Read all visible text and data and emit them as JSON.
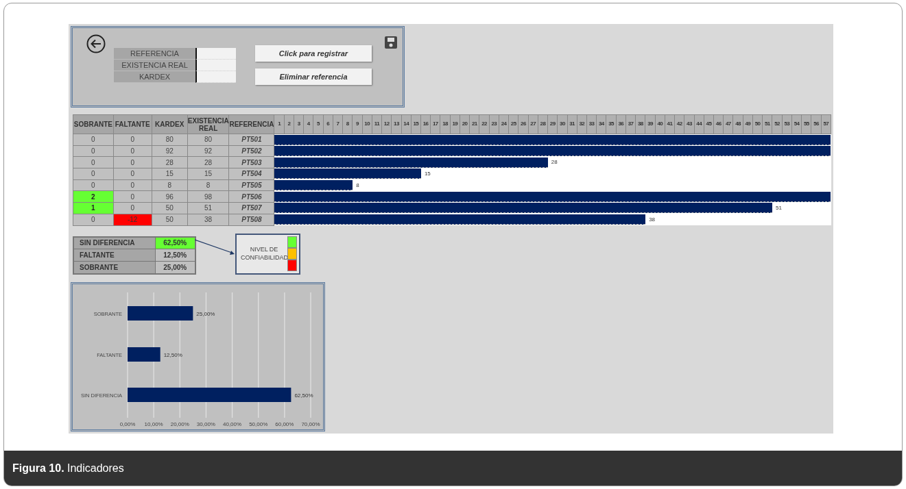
{
  "form": {
    "fields": [
      {
        "label": "REFERENCIA"
      },
      {
        "label": "EXISTENCIA REAL"
      },
      {
        "label": "KARDEX"
      }
    ],
    "buttons": [
      "Click para registrar",
      "Eliminar referencia"
    ]
  },
  "table": {
    "columns": [
      "SOBRANTE",
      "FALTANTE",
      "KARDEX",
      "EXISTENCIA REAL",
      "REFERENCIA"
    ],
    "column_numbers": [
      "1",
      "2",
      "3",
      "4",
      "5",
      "6",
      "7",
      "8",
      "9",
      "10",
      "11",
      "12",
      "13",
      "14",
      "15",
      "16",
      "17",
      "18",
      "19",
      "20",
      "21",
      "22",
      "23",
      "24",
      "25",
      "26",
      "27",
      "28",
      "29",
      "30",
      "31",
      "32",
      "33",
      "34",
      "35",
      "36",
      "37",
      "38",
      "39",
      "40",
      "41",
      "42",
      "43",
      "44",
      "45",
      "46",
      "47",
      "48",
      "49",
      "50",
      "51",
      "52",
      "53",
      "54",
      "55",
      "56",
      "57"
    ],
    "rows": [
      {
        "kind": "match",
        "sobrante": "0",
        "faltante": "0",
        "kardex": "80",
        "existencia_real": "80",
        "referencia": "PT501",
        "level": 1
      },
      {
        "kind": "match",
        "sobrante": "0",
        "faltante": "0",
        "kardex": "92",
        "existencia_real": "92",
        "referencia": "PT502",
        "level": 1
      },
      {
        "kind": "match",
        "sobrante": "0",
        "faltante": "0",
        "kardex": "28",
        "existencia_real": "28",
        "referencia": "PT503",
        "level": 0.4912,
        "bar_label": "28"
      },
      {
        "kind": "match",
        "sobrante": "0",
        "faltante": "0",
        "kardex": "15",
        "existencia_real": "15",
        "referencia": "PT504",
        "level": 0.2632,
        "bar_label": "15"
      },
      {
        "kind": "match",
        "sobrante": "0",
        "faltante": "0",
        "kardex": "8",
        "existencia_real": "8",
        "referencia": "PT505",
        "level": 0.1404,
        "bar_label": "8"
      },
      {
        "kind": "over",
        "sobrante": "2",
        "faltante": "0",
        "kardex": "96",
        "existencia_real": "98",
        "referencia": "PT506",
        "level": 1
      },
      {
        "kind": "over",
        "sobrante": "1",
        "faltante": "0",
        "kardex": "50",
        "existencia_real": "51",
        "referencia": "PT507",
        "level": 0.8947,
        "bar_label": "51"
      },
      {
        "kind": "short",
        "sobrante": "0",
        "faltante": "-12",
        "kardex": "50",
        "existencia_real": "38",
        "referencia": "PT508",
        "level": 0.6667,
        "bar_label": "38"
      }
    ]
  },
  "summary": [
    {
      "label": "SIN DIFERENCIA",
      "value": "62,50%",
      "highlighted": true
    },
    {
      "label": "FALTANTE",
      "value": "12,50%",
      "highlighted": false
    },
    {
      "label": "SOBRANTE",
      "value": "25,00%",
      "highlighted": false
    }
  ],
  "reliability": {
    "label": "NIVEL DE CONFIABILIDAD",
    "levels": [
      {
        "color": "#66ff33"
      },
      {
        "color": "#ffc000"
      },
      {
        "color": "#ff0000"
      }
    ]
  },
  "chart": {
    "chart_data": {
      "type": "bar",
      "orientation": "horizontal",
      "categories": [
        "SOBRANTE",
        "FALTANTE",
        "SIN DIFERENCIA"
      ],
      "series": [
        {
          "color": "#002060",
          "values": [
            25,
            12.5,
            62.5
          ]
        }
      ],
      "xlim": [
        0,
        70
      ],
      "grid": true,
      "xticks": [
        {
          "value": 0,
          "label": "0,00%"
        },
        {
          "value": 10,
          "label": "10,00%"
        },
        {
          "value": 20,
          "label": "20,00%"
        },
        {
          "value": 30,
          "label": "30,00%"
        },
        {
          "value": 40,
          "label": "40,00%"
        },
        {
          "value": 50,
          "label": "50,00%"
        },
        {
          "value": 60,
          "label": "60,00%"
        },
        {
          "value": 70,
          "label": "70,00%"
        }
      ],
      "value_labels": [
        "25,00%",
        "12,50%",
        "62,50%"
      ]
    }
  },
  "caption": "**Figura 10.** Indicadores"
}
